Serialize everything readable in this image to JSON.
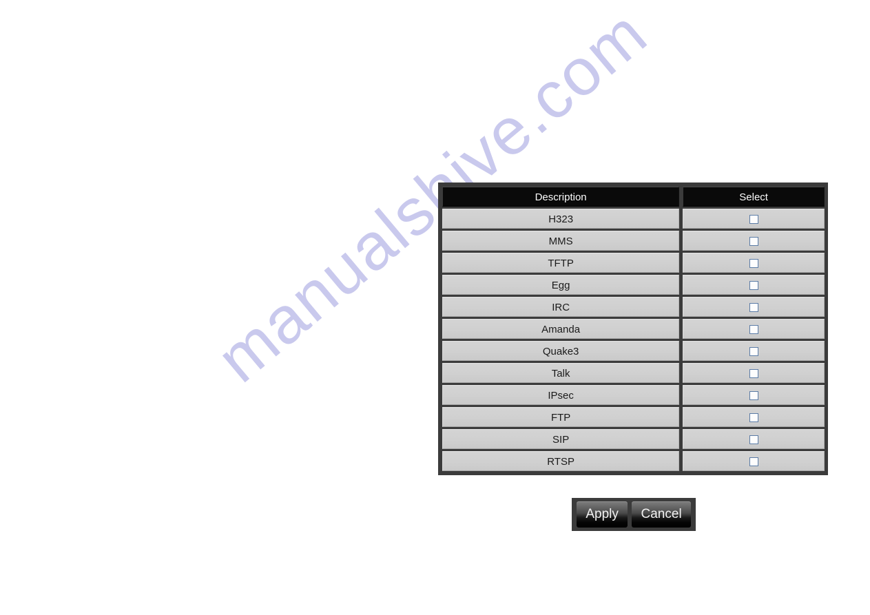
{
  "page": {
    "watermark": "manualshive.com",
    "watermark_color": "#c9c9ed",
    "background_color": "#ffffff"
  },
  "alg_table": {
    "columns": [
      {
        "key": "description",
        "label": "Description"
      },
      {
        "key": "select",
        "label": "Select"
      }
    ],
    "header_bg": "#0a0a0a",
    "header_text_color": "#ffffff",
    "row_bg": "#d2d2d2",
    "frame_color": "#3b3b3b",
    "rows": [
      {
        "description": "H323",
        "selected": false
      },
      {
        "description": "MMS",
        "selected": false
      },
      {
        "description": "TFTP",
        "selected": false
      },
      {
        "description": "Egg",
        "selected": false
      },
      {
        "description": "IRC",
        "selected": false
      },
      {
        "description": "Amanda",
        "selected": false
      },
      {
        "description": "Quake3",
        "selected": false
      },
      {
        "description": "Talk",
        "selected": false
      },
      {
        "description": "IPsec",
        "selected": false
      },
      {
        "description": "FTP",
        "selected": false
      },
      {
        "description": "SIP",
        "selected": false
      },
      {
        "description": "RTSP",
        "selected": false
      }
    ]
  },
  "buttons": {
    "apply_label": "Apply",
    "cancel_label": "Cancel"
  }
}
